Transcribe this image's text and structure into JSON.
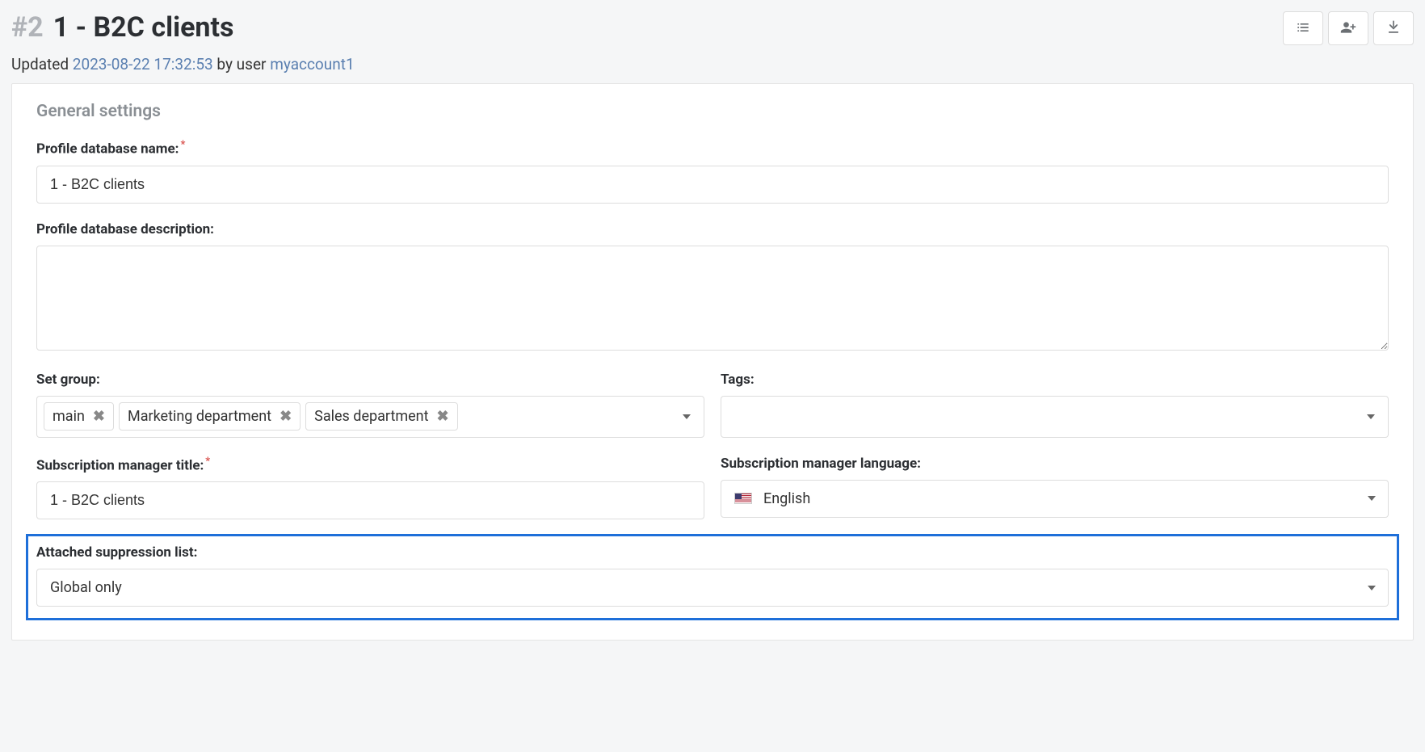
{
  "header": {
    "id_prefix": "#2",
    "title": "1 - B2C clients",
    "updated_label": "Updated ",
    "updated_timestamp": "2023-08-22 17:32:53",
    "updated_by_label": " by user ",
    "updated_by_user": "myaccount1"
  },
  "section": {
    "title": "General settings"
  },
  "fields": {
    "name_label": "Profile database name:",
    "name_value": "1 - B2C clients",
    "description_label": "Profile database description:",
    "description_value": "",
    "group_label": "Set group:",
    "groups": [
      "main",
      "Marketing department",
      "Sales department"
    ],
    "tags_label": "Tags:",
    "subscription_title_label": "Subscription manager title:",
    "subscription_title_value": "1 - B2C clients",
    "language_label": "Subscription manager language:",
    "language_value": "English",
    "suppression_label": "Attached suppression list:",
    "suppression_value": "Global only"
  }
}
